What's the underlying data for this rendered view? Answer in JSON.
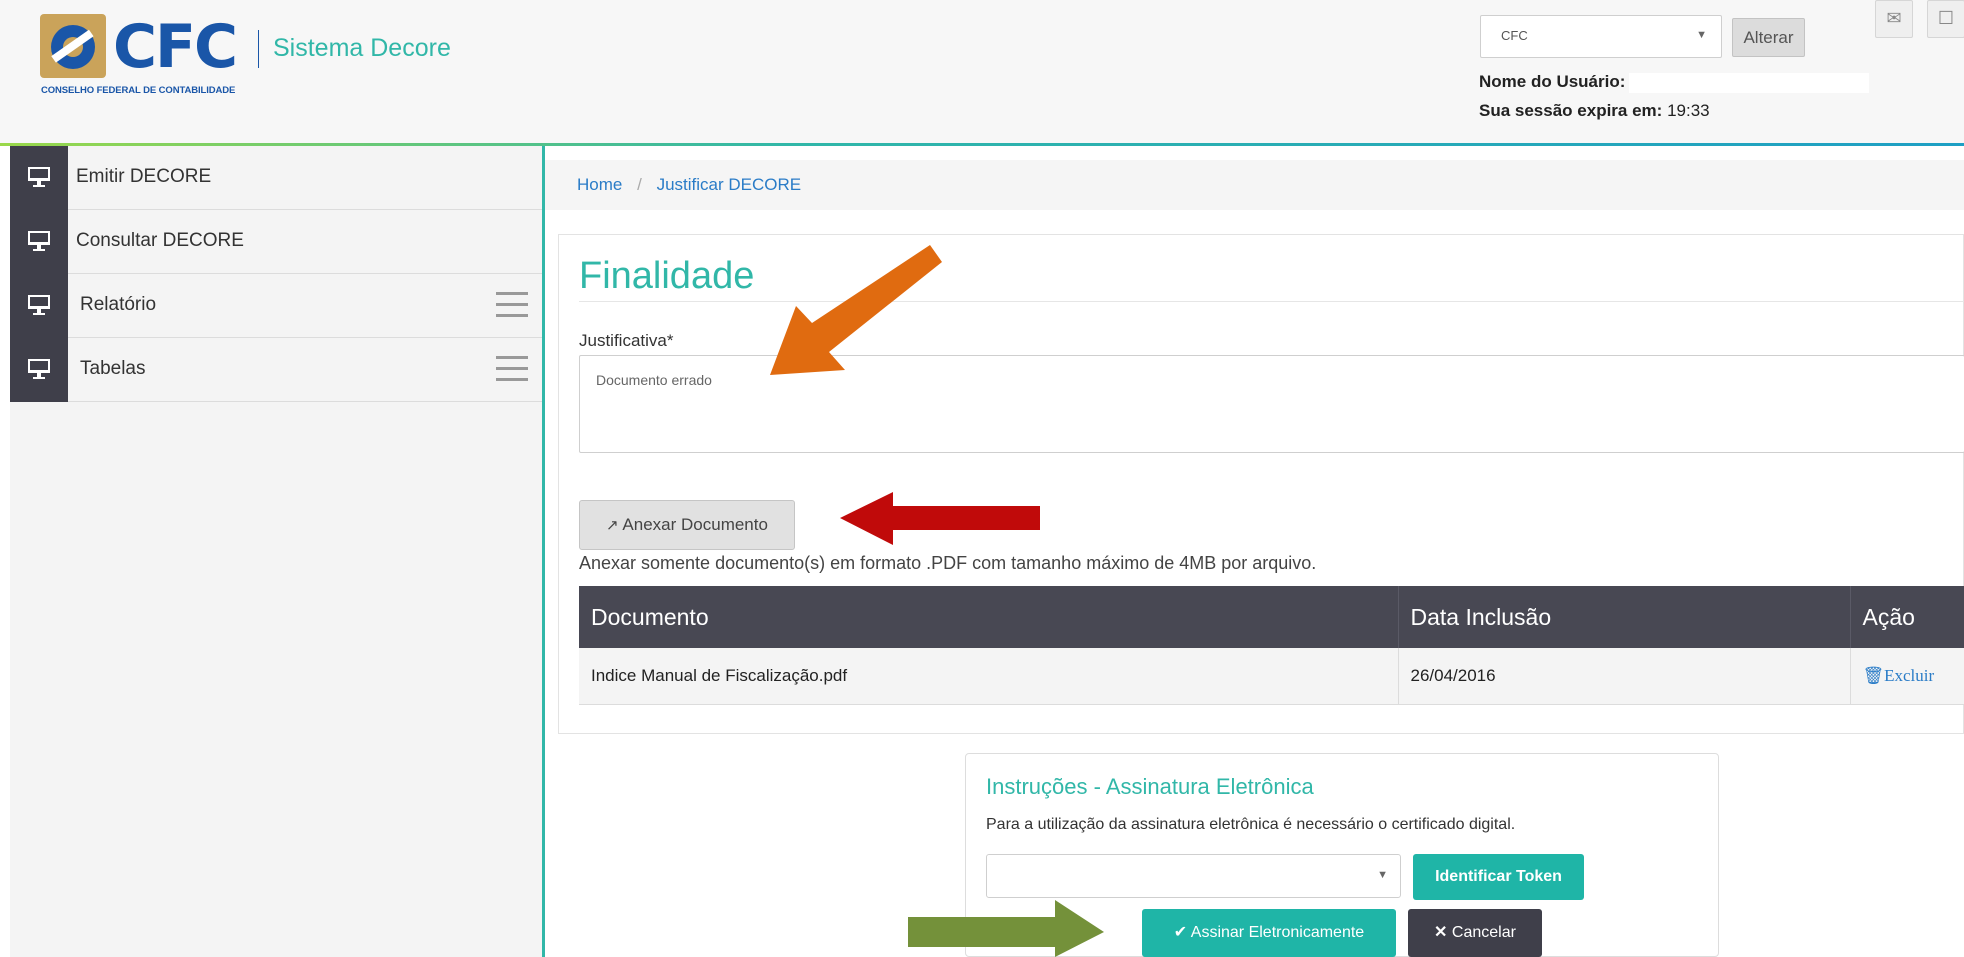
{
  "header": {
    "logo_text": "CFC",
    "logo_subtitle": "CONSELHO FEDERAL DE CONTABILIDADE",
    "system_name": "Sistema Decore",
    "org_select_value": "CFC",
    "alterar_label": "Alterar",
    "user_label": "Nome do Usuário:",
    "session_label": "Sua sessão expira em:",
    "session_time": "19:33"
  },
  "sidebar": {
    "items": [
      {
        "label": "Emitir DECORE"
      },
      {
        "label": "Consultar DECORE"
      },
      {
        "label": "Relatório"
      },
      {
        "label": "Tabelas"
      }
    ]
  },
  "breadcrumb": {
    "home": "Home",
    "separator": "/",
    "current": "Justificar DECORE"
  },
  "form": {
    "title": "Finalidade",
    "justificativa_label": "Justificativa*",
    "justificativa_value": "Documento errado",
    "attach_label": "Anexar Documento",
    "attach_note": "Anexar somente documento(s) em formato .PDF com tamanho máximo de 4MB por arquivo."
  },
  "table": {
    "headers": [
      "Documento",
      "Data Inclusão",
      "Ação"
    ],
    "rows": [
      {
        "documento": "Indice Manual de Fiscalização.pdf",
        "data": "26/04/2016",
        "acao": "Excluir"
      }
    ]
  },
  "signature": {
    "title": "Instruções - Assinatura Eletrônica",
    "text": "Para a utilização da assinatura eletrônica é necessário o certificado digital.",
    "identify_label": "Identificar Token",
    "sign_label": "Assinar Eletronicamente",
    "cancel_label": "Cancelar"
  },
  "colors": {
    "accent": "#31b7a8",
    "sidebar_dark": "#3f3f4a",
    "link": "#2a7cc7",
    "arrow_orange": "#e06b10",
    "arrow_red": "#c00a0a",
    "arrow_green": "#74913a"
  }
}
